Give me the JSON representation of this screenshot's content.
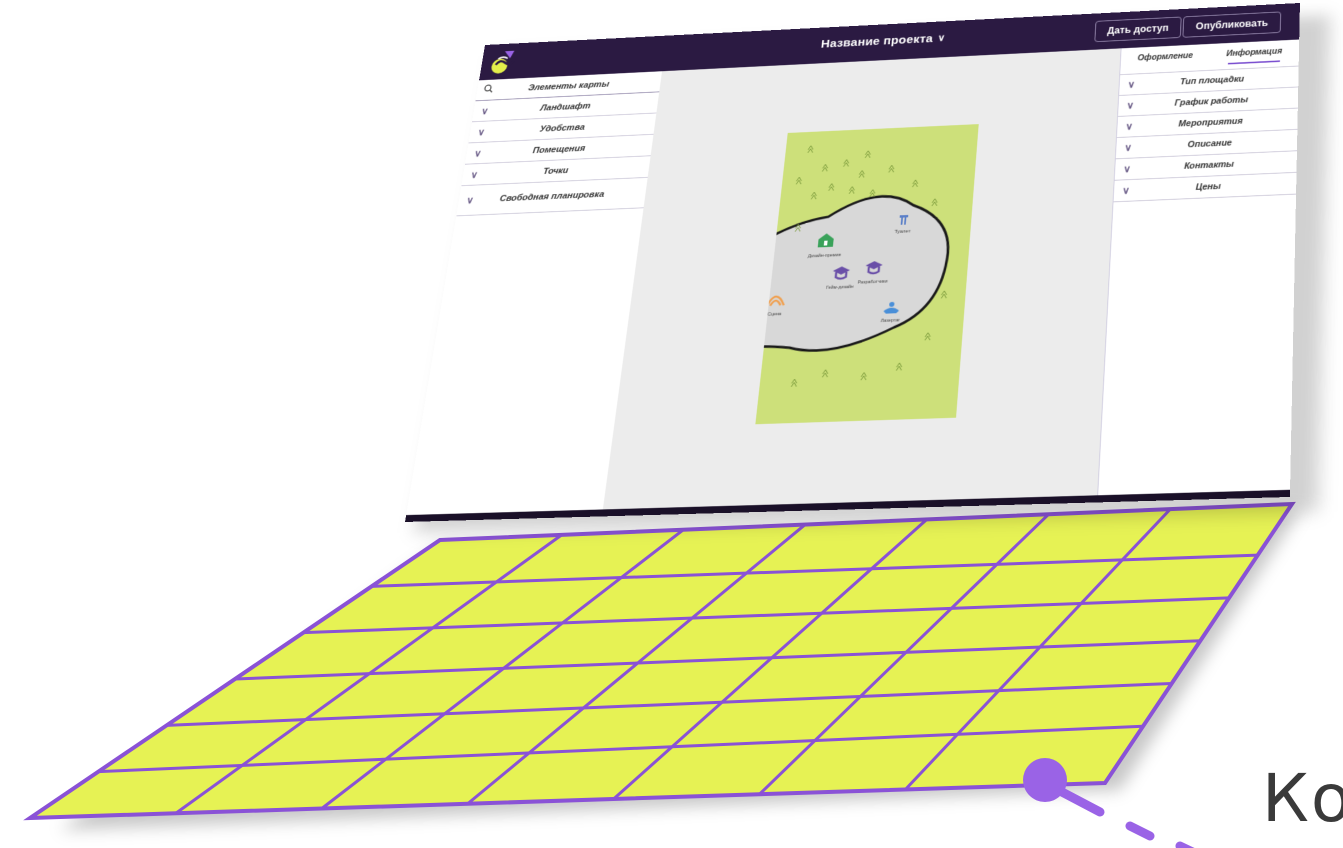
{
  "header": {
    "project_title": "Название проекта",
    "share_button": "Дать доступ",
    "publish_button": "Опубликовать"
  },
  "left_panel": {
    "search_label": "Элементы карты",
    "items": [
      {
        "label": "Ландшафт"
      },
      {
        "label": "Удобства"
      },
      {
        "label": "Помещения"
      },
      {
        "label": "Точки"
      },
      {
        "label": "Свободная планировка"
      }
    ]
  },
  "right_panel": {
    "tabs": [
      "Оформление",
      "Информация"
    ],
    "active_tab": "Информация",
    "items": [
      {
        "label": "Тип площадки"
      },
      {
        "label": "График работы"
      },
      {
        "label": "Мероприятия"
      },
      {
        "label": "Описание"
      },
      {
        "label": "Контакты"
      },
      {
        "label": "Цены"
      }
    ]
  },
  "map": {
    "points": [
      {
        "label": "Туалет",
        "icon": "toilet-icon",
        "color": "#5a7fc8"
      },
      {
        "label": "Дизайн-премия",
        "icon": "tent-icon",
        "color": "#3aa25a"
      },
      {
        "label": "Гейм-дизайн",
        "icon": "graduation-cap-icon",
        "color": "#6a4fa8"
      },
      {
        "label": "Разработчики",
        "icon": "graduation-cap-icon",
        "color": "#6a4fa8"
      },
      {
        "label": "Сцена",
        "icon": "stage-icon",
        "color": "#f0a050"
      },
      {
        "label": "Лазертаг",
        "icon": "laser-tag-icon",
        "color": "#4a8fd8"
      }
    ]
  },
  "colors": {
    "header_bg": "#2b1a42",
    "accent": "#7b4fd0",
    "grass": "#cde07a",
    "keyboard": "#e6f254",
    "keyboard_lines": "#8a52d6"
  },
  "caption": {
    "text": "Ко"
  }
}
